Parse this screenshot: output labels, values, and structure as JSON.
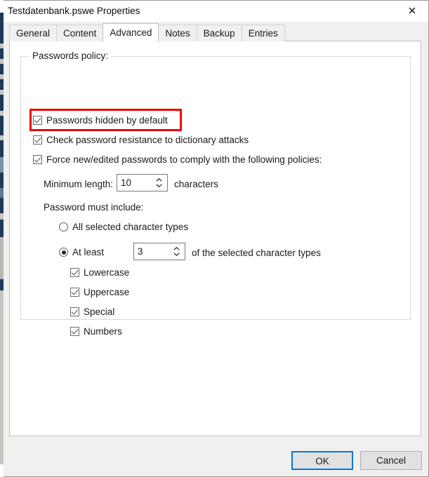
{
  "window": {
    "title": "Testdatenbank.pswe Properties",
    "close_icon": "close-icon"
  },
  "tabs": [
    {
      "label": "General",
      "selected": false
    },
    {
      "label": "Content",
      "selected": false
    },
    {
      "label": "Advanced",
      "selected": true
    },
    {
      "label": "Notes",
      "selected": false
    },
    {
      "label": "Backup",
      "selected": false
    },
    {
      "label": "Entries",
      "selected": false
    }
  ],
  "groupbox": {
    "label": "Passwords policy:"
  },
  "options": {
    "passwords_hidden": {
      "label": "Passwords hidden by default",
      "checked": true,
      "highlighted": true
    },
    "dictionary_check": {
      "label": "Check password resistance to dictionary attacks",
      "checked": true
    },
    "force_policies": {
      "label": "Force new/edited passwords to comply with the following policies:",
      "checked": true
    }
  },
  "minimum_length": {
    "label": "Minimum length:",
    "value": "10",
    "suffix": "characters"
  },
  "must_include": {
    "label": "Password must include:",
    "mode_all": {
      "label": "All selected character types",
      "selected": false
    },
    "mode_at_least": {
      "label": "At least",
      "selected": true,
      "value": "3",
      "suffix": "of the selected character types"
    },
    "character_types": [
      {
        "label": "Lowercase",
        "checked": true
      },
      {
        "label": "Uppercase",
        "checked": true
      },
      {
        "label": "Special",
        "checked": true
      },
      {
        "label": "Numbers",
        "checked": true
      }
    ]
  },
  "footer": {
    "ok_label": "OK",
    "cancel_label": "Cancel"
  },
  "colors": {
    "accent": "#0078d7",
    "highlight": "#ee0000",
    "dialog_bg": "#f0f0f0",
    "panel_bg": "#ffffff",
    "backdrop_strip": "#1b3a5c"
  }
}
